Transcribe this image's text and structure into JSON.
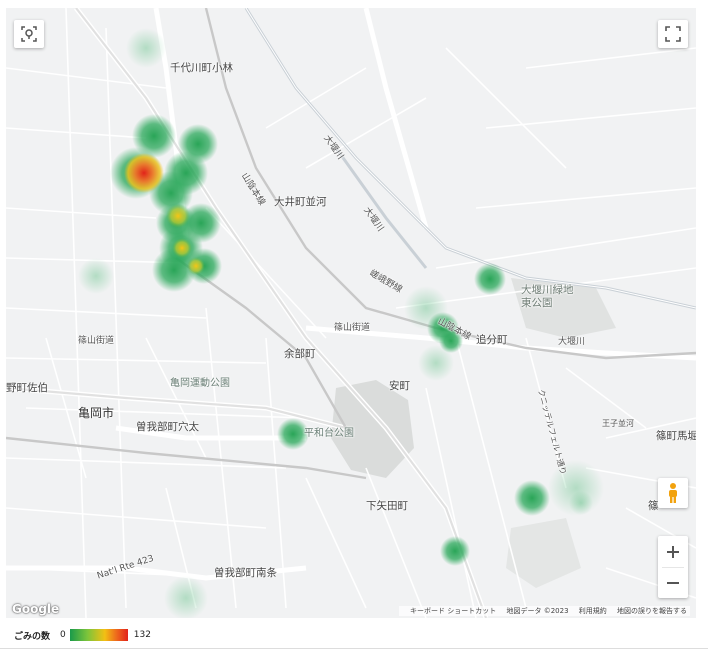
{
  "map": {
    "labels": {
      "sendai_kobayashi": "千代川町小林",
      "sanin_line_1": "山陰本線",
      "oi_namikawa": "大井町並河",
      "okawa": "大堰川",
      "hozugawa": "大堰川",
      "sagano_line": "嵯峨野線",
      "oigawa_ryokuchi": "大堰川緑地\n東公園",
      "sasayama_kaido_w": "篠山街道",
      "sasayama_kaido_c": "篠山街道",
      "sanin_line_2": "山陰本線",
      "oibunmachi": "追分町",
      "oigawa_e": "大堰川",
      "amabe": "余部町",
      "kameoka_park": "亀岡運動公園",
      "yasumachi": "安町",
      "nozusa": "野町佐伯",
      "kameoka_city": "亀岡市",
      "sogabe_anao": "曽我部町穴太",
      "heiwadai": "平和台公園",
      "country_way": "クニッテルフェルト通り",
      "ojigasawa": "王子並河",
      "shinohara": "篠町馬堀",
      "shimoyata": "下矢田町",
      "natl_423": "Nat'l Rte 423",
      "sogabe_minami": "曽我部町南条",
      "shino": "篠"
    },
    "google_logo": "Google",
    "attribution": [
      "キーボード ショートカット",
      "地図データ ©2023",
      "利用規約",
      "地図の誤りを報告する"
    ],
    "colors": {
      "land": "#f1f2f3",
      "road": "#ffffff",
      "major_road": "#e3e3e3",
      "rail": "#c9c9c9",
      "river": "#c8cfd6",
      "park": "#d3d6d4"
    },
    "heatspots": [
      {
        "name": "north-cluster-hot",
        "intensity": 132
      },
      {
        "name": "north-cluster-mid",
        "intensity": 80
      },
      {
        "name": "north-cluster-south",
        "intensity": 60
      },
      {
        "name": "east-station",
        "intensity": 20
      },
      {
        "name": "sanin-line-east",
        "intensity": 25
      },
      {
        "name": "heiwadai-park",
        "intensity": 18
      },
      {
        "name": "southeast-spot",
        "intensity": 22
      },
      {
        "name": "south-spot",
        "intensity": 18
      }
    ]
  },
  "legend": {
    "title": "ごみの数",
    "min": "0",
    "max": "132"
  }
}
